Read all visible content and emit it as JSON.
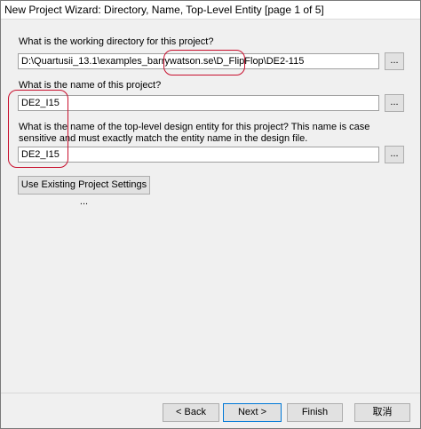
{
  "window": {
    "title": "New Project Wizard: Directory, Name, Top-Level Entity [page 1 of 5]"
  },
  "working_directory": {
    "prompt": "What is the working directory for this project?",
    "value": "D:\\Quartusii_13.1\\examples_barrywatson.se\\D_FlipFlop\\DE2-115",
    "browse_label": "..."
  },
  "project_name": {
    "prompt": "What is the name of this project?",
    "value": "DE2_I15",
    "browse_label": "..."
  },
  "top_level_entity": {
    "prompt": "What is the name of the top-level design entity for this project? This name is case sensitive and must exactly match the entity name in the design file.",
    "value": "DE2_I15",
    "browse_label": "..."
  },
  "existing_settings_button": "Use Existing Project Settings ...",
  "footer": {
    "back": "< Back",
    "next": "Next >",
    "finish": "Finish",
    "cancel": "取消"
  },
  "colors": {
    "highlight": "#c8102e",
    "focus": "#0078d7"
  }
}
